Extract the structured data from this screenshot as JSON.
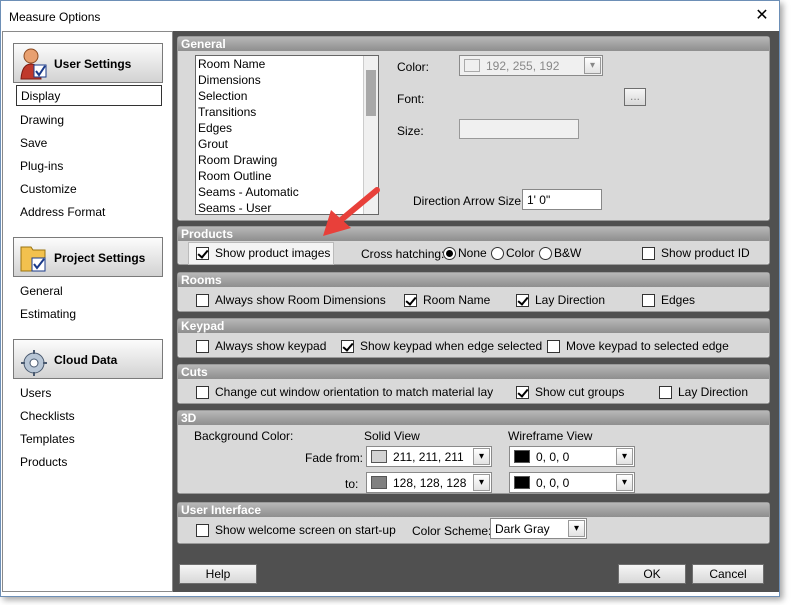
{
  "window": {
    "title": "Measure Options",
    "close_glyph": "✕"
  },
  "sidebar": {
    "user_settings": {
      "label": "User Settings",
      "items": [
        "Display",
        "Drawing",
        "Save",
        "Plug-ins",
        "Customize",
        "Address Format"
      ]
    },
    "project_settings": {
      "label": "Project Settings",
      "items": [
        "General",
        "Estimating"
      ]
    },
    "cloud_data": {
      "label": "Cloud Data",
      "items": [
        "Users",
        "Checklists",
        "Templates",
        "Products"
      ]
    }
  },
  "general": {
    "header": "General",
    "list_items": [
      "Room Name",
      "Dimensions",
      "Selection",
      "Transitions",
      "Edges",
      "Grout",
      "Room Drawing",
      "Room Outline",
      "Seams - Automatic",
      "Seams - User"
    ],
    "color_label": "Color:",
    "color_value": "192, 255, 192",
    "font_label": "Font:",
    "font_button": "...",
    "size_label": "Size:",
    "arrow_label": "Direction Arrow Size:",
    "arrow_value": "1' 0\""
  },
  "products": {
    "header": "Products",
    "show_images": "Show product images",
    "cross_label": "Cross hatching:",
    "options": [
      "None",
      "Color",
      "B&W"
    ],
    "show_id": "Show product ID"
  },
  "rooms": {
    "header": "Rooms",
    "always_dims": "Always show Room Dimensions",
    "room_name": "Room Name",
    "lay_direction": "Lay Direction",
    "edges": "Edges"
  },
  "keypad": {
    "header": "Keypad",
    "always": "Always show keypad",
    "when_edge": "Show keypad when edge selected",
    "move": "Move keypad to selected edge"
  },
  "cuts": {
    "header": "Cuts",
    "change": "Change cut window orientation to match material lay",
    "groups": "Show cut groups",
    "lay": "Lay Direction"
  },
  "three_d": {
    "header": "3D",
    "bg_label": "Background Color:",
    "solid_label": "Solid View",
    "wire_label": "Wireframe View",
    "fade_label": "Fade from:",
    "to_label": "to:",
    "solid_from": "211, 211, 211",
    "solid_to": "128, 128, 128",
    "wire_from": "0, 0, 0",
    "wire_to": "0, 0, 0"
  },
  "ui": {
    "header": "User Interface",
    "welcome": "Show welcome screen on start-up",
    "scheme_label": "Color Scheme:",
    "scheme_value": "Dark Gray"
  },
  "buttons": {
    "help": "Help",
    "ok": "OK",
    "cancel": "Cancel"
  },
  "colors": {
    "swatch_general": "#c0ffc0",
    "swatch_solid_from": "#d3d3d3",
    "swatch_solid_to": "#808080",
    "swatch_wire": "#000000",
    "annotation_arrow": "#e8403a"
  }
}
